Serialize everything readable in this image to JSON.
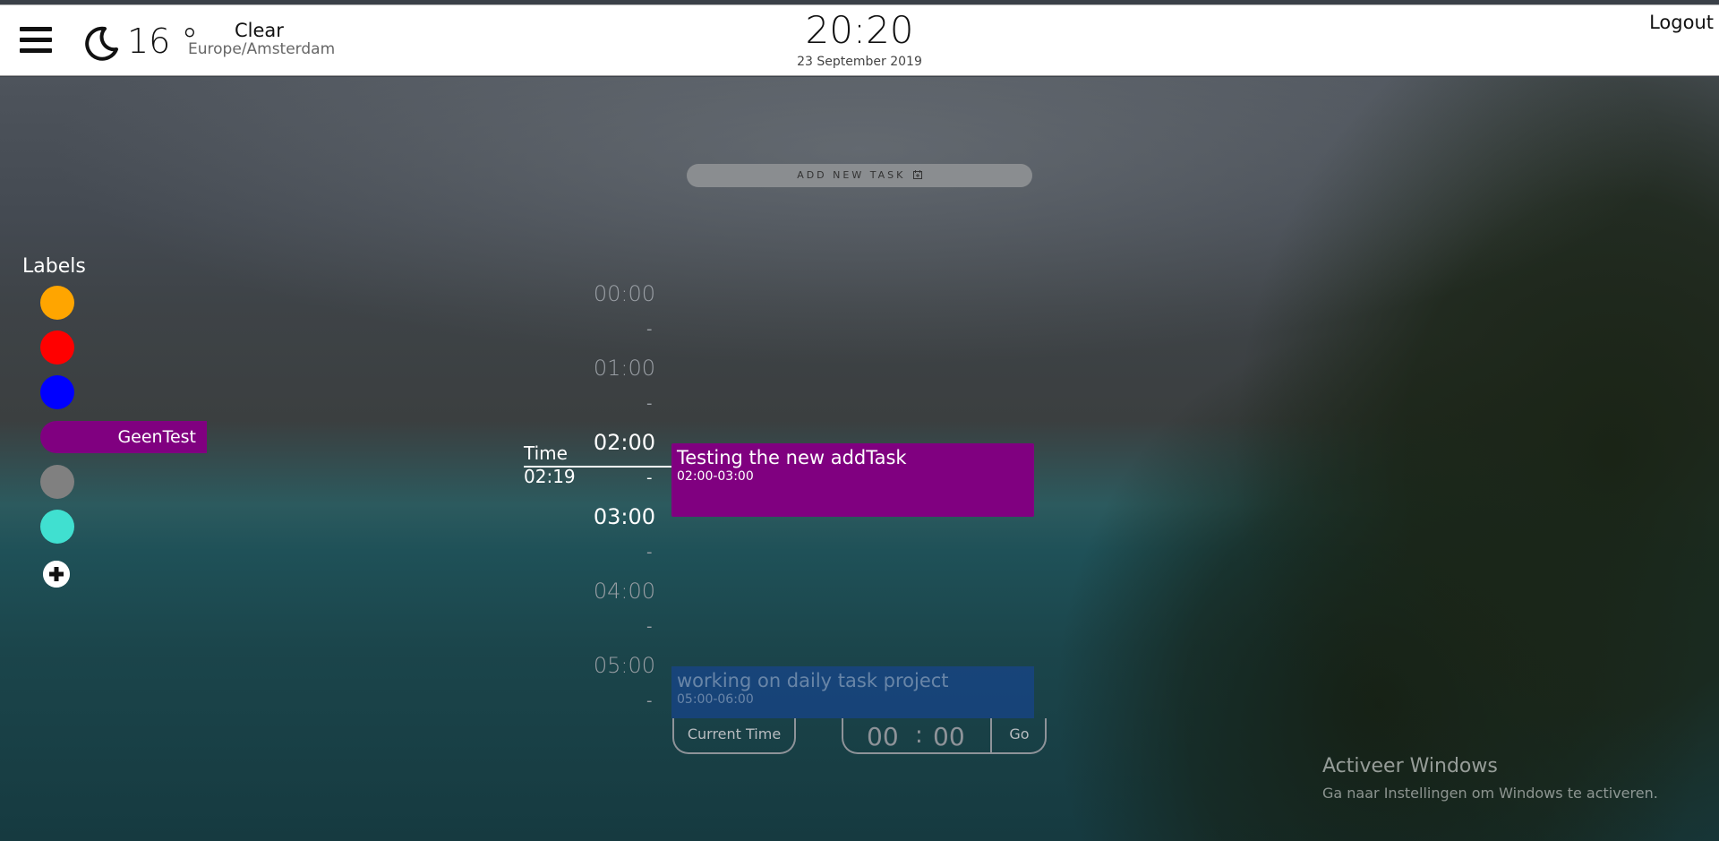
{
  "header": {
    "temperature": "16 °",
    "condition": "Clear",
    "timezone": "Europe/Amsterdam",
    "clock": "20:20",
    "date": "23 September 2019",
    "logout_label": "Logout"
  },
  "labels": {
    "title": "Labels",
    "items": [
      {
        "color": "#FFA500"
      },
      {
        "color": "#FF0000"
      },
      {
        "color": "#0000FF"
      },
      {
        "color": "#800080",
        "name": "GeenTest"
      },
      {
        "color": "#808080"
      },
      {
        "color": "#40E0D0"
      }
    ]
  },
  "add_task_label": "ADD NEW TASK",
  "timeline": {
    "hours": [
      "00:00",
      "01:00",
      "02:00",
      "03:00",
      "04:00",
      "05:00"
    ],
    "dash": "-",
    "now_label": "Time",
    "now_time": "02:19"
  },
  "tasks": [
    {
      "title": "Testing the new addTask",
      "time": "02:00-03:00",
      "color": "#800080"
    },
    {
      "title": "working on daily task project",
      "time": "05:00-06:00",
      "color": "#1646a0"
    }
  ],
  "controls": {
    "current_time_label": "Current Time",
    "hour_value": "00",
    "minute_value": "00",
    "separator": ":",
    "go_label": "Go"
  },
  "watermark": {
    "title": "Activeer Windows",
    "subtitle": "Ga naar Instellingen om Windows te activeren."
  }
}
